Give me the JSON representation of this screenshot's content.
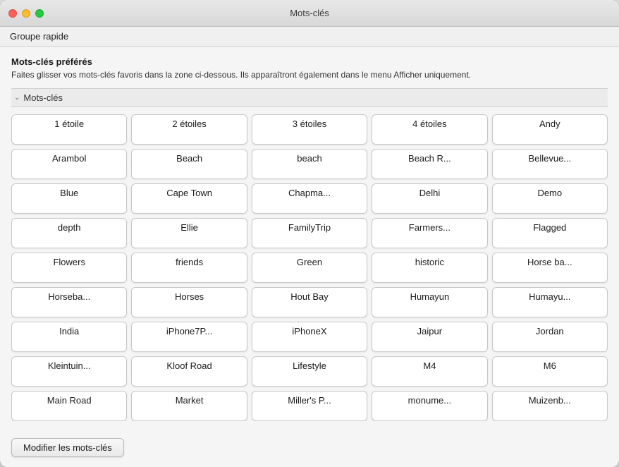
{
  "window": {
    "title": "Mots-clés"
  },
  "toolbar": {
    "groupe_rapide": "Groupe rapide"
  },
  "section": {
    "title": "Mots-clés préférés",
    "description": "Faites glisser vos mots-clés favoris dans la zone ci-dessous. Ils apparaîtront également dans le menu Afficher uniquement.",
    "keywords_header": "Mots-clés"
  },
  "keywords": [
    "1 étoile",
    "2 étoiles",
    "3 étoiles",
    "4 étoiles",
    "Andy",
    "Arambol",
    "Beach",
    "beach",
    "Beach R...",
    "Bellevue...",
    "Blue",
    "Cape Town",
    "Chapma...",
    "Delhi",
    "Demo",
    "depth",
    "Ellie",
    "FamilyTrip",
    "Farmers...",
    "Flagged",
    "Flowers",
    "friends",
    "Green",
    "historic",
    "Horse ba...",
    "Horseba...",
    "Horses",
    "Hout Bay",
    "Humayun",
    "Humayu...",
    "India",
    "iPhone7P...",
    "iPhoneX",
    "Jaipur",
    "Jordan",
    "Kleintuin...",
    "Kloof Road",
    "Lifestyle",
    "M4",
    "M6",
    "Main Road",
    "Market",
    "Miller's P...",
    "monume...",
    "Muizenb..."
  ],
  "footer": {
    "button_label": "Modifier les mots-clés"
  },
  "traffic_lights": {
    "close": "close",
    "minimize": "minimize",
    "maximize": "maximize"
  }
}
